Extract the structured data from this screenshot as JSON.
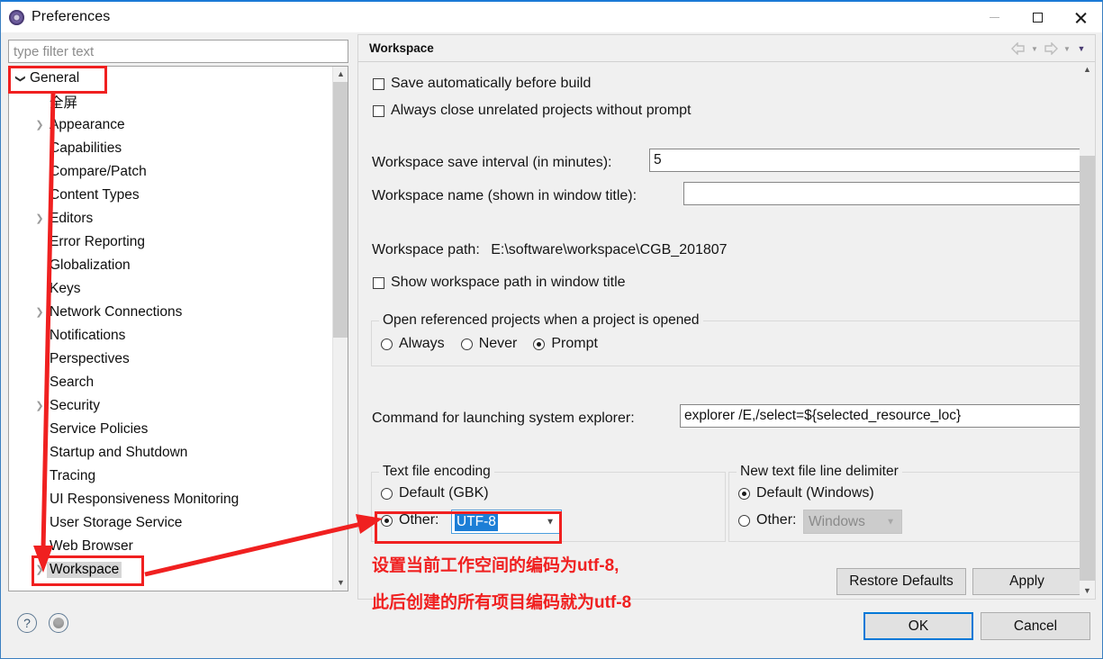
{
  "window": {
    "title": "Preferences",
    "icon": "gear-icon",
    "controls": {
      "minimize": "–",
      "maximize": "□",
      "close": "✕"
    }
  },
  "filter": {
    "placeholder": "type filter text",
    "value": ""
  },
  "tree": {
    "items": [
      {
        "label": "General",
        "level": 0,
        "chevron": "down",
        "selected": false
      },
      {
        "label": "全屏",
        "level": 1,
        "chevron": "none",
        "selected": false
      },
      {
        "label": "Appearance",
        "level": 1,
        "chevron": "right",
        "selected": false
      },
      {
        "label": "Capabilities",
        "level": 1,
        "chevron": "none",
        "selected": false
      },
      {
        "label": "Compare/Patch",
        "level": 1,
        "chevron": "none",
        "selected": false
      },
      {
        "label": "Content Types",
        "level": 1,
        "chevron": "none",
        "selected": false
      },
      {
        "label": "Editors",
        "level": 1,
        "chevron": "right",
        "selected": false
      },
      {
        "label": "Error Reporting",
        "level": 1,
        "chevron": "none",
        "selected": false
      },
      {
        "label": "Globalization",
        "level": 1,
        "chevron": "none",
        "selected": false
      },
      {
        "label": "Keys",
        "level": 1,
        "chevron": "none",
        "selected": false
      },
      {
        "label": "Network Connections",
        "level": 1,
        "chevron": "right",
        "selected": false
      },
      {
        "label": "Notifications",
        "level": 1,
        "chevron": "none",
        "selected": false
      },
      {
        "label": "Perspectives",
        "level": 1,
        "chevron": "none",
        "selected": false
      },
      {
        "label": "Search",
        "level": 1,
        "chevron": "none",
        "selected": false
      },
      {
        "label": "Security",
        "level": 1,
        "chevron": "right",
        "selected": false
      },
      {
        "label": "Service Policies",
        "level": 1,
        "chevron": "none",
        "selected": false
      },
      {
        "label": "Startup and Shutdown",
        "level": 1,
        "chevron": "none",
        "selected": false
      },
      {
        "label": "Tracing",
        "level": 1,
        "chevron": "none",
        "selected": false
      },
      {
        "label": "UI Responsiveness Monitoring",
        "level": 1,
        "chevron": "none",
        "selected": false
      },
      {
        "label": "User Storage Service",
        "level": 1,
        "chevron": "none",
        "selected": false
      },
      {
        "label": "Web Browser",
        "level": 1,
        "chevron": "none",
        "selected": false
      },
      {
        "label": "Workspace",
        "level": 1,
        "chevron": "right",
        "selected": true
      }
    ]
  },
  "pane": {
    "title": "Workspace",
    "checkboxes": [
      {
        "label": "Save automatically before build",
        "checked": false
      },
      {
        "label": "Always close unrelated projects without prompt",
        "checked": false
      }
    ],
    "save_interval": {
      "label": "Workspace save interval (in minutes):",
      "value": "5"
    },
    "workspace_name": {
      "label": "Workspace name (shown in window title):",
      "value": ""
    },
    "workspace_path": {
      "label": "Workspace path:",
      "value": "E:\\software\\workspace\\CGB_201807"
    },
    "show_path_checkbox": {
      "label": "Show workspace path in window title",
      "checked": false
    },
    "open_referenced": {
      "title": "Open referenced projects when a project is opened",
      "options": [
        {
          "label": "Always",
          "selected": false
        },
        {
          "label": "Never",
          "selected": false
        },
        {
          "label": "Prompt",
          "selected": true
        }
      ]
    },
    "explorer_command": {
      "label": "Command for launching system explorer:",
      "value": "explorer /E,/select=${selected_resource_loc}"
    },
    "text_file_encoding": {
      "title": "Text file encoding",
      "default_option": {
        "label": "Default (GBK)",
        "selected": false
      },
      "other_option": {
        "label": "Other:",
        "selected": true,
        "value": "UTF-8"
      }
    },
    "line_delimiter": {
      "title": "New text file line delimiter",
      "default_option": {
        "label": "Default (Windows)",
        "selected": true
      },
      "other_option": {
        "label": "Other:",
        "selected": false,
        "value": "Windows",
        "disabled": true
      }
    },
    "restore_defaults_label": "Restore Defaults",
    "apply_label": "Apply"
  },
  "footer": {
    "help_icon": "?",
    "ok_label": "OK",
    "cancel_label": "Cancel"
  },
  "annotations": {
    "line1": "设置当前工作空间的编码为utf-8,",
    "line2": "此后创建的所有项目编码就为utf-8",
    "color": "#f02020"
  }
}
